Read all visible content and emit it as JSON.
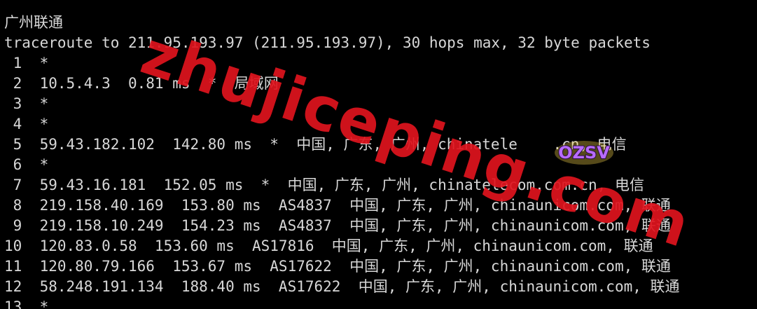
{
  "terminal": {
    "rule": "--------------------------------------------------------------------------------------------------",
    "title": "广州联通",
    "command": "traceroute to 211.95.193.97 (211.95.193.97), 30 hops max, 32 byte packets",
    "hops": [
      " 1  *",
      " 2  10.5.4.3  0.81 ms  *  局域网",
      " 3  *",
      " 4  *",
      " 5  59.43.182.102  142.80 ms  *  中国, 广东, 广州, chinatele    .cn, 电信",
      " 6  *",
      " 7  59.43.16.181  152.05 ms  *  中国, 广东, 广州, chinatelecom.com.cn, 电信",
      " 8  219.158.40.169  153.80 ms  AS4837  中国, 广东, 广州, chinaunicom.com, 联通",
      " 9  219.158.10.249  154.23 ms  AS4837  中国, 广东, 广州, chinaunicom.com, 联通",
      "10  120.83.0.58  153.60 ms  AS17816  中国, 广东, 广州, chinaunicom.com, 联通",
      "11  120.80.79.166  153.67 ms  AS17622  中国, 广东, 广州, chinaunicom.com, 联通",
      "12  58.248.191.134  188.40 ms  AS17622  中国, 广东, 广州, chinaunicom.com, 联通",
      "13  *"
    ]
  },
  "watermark": {
    "text": "zhujiceping.com",
    "color": "#e0141e"
  },
  "logo": {
    "text": "OZSV",
    "icon": "ozsv-logo-icon"
  },
  "colors": {
    "background": "#000000",
    "text": "#d8d8d8"
  }
}
